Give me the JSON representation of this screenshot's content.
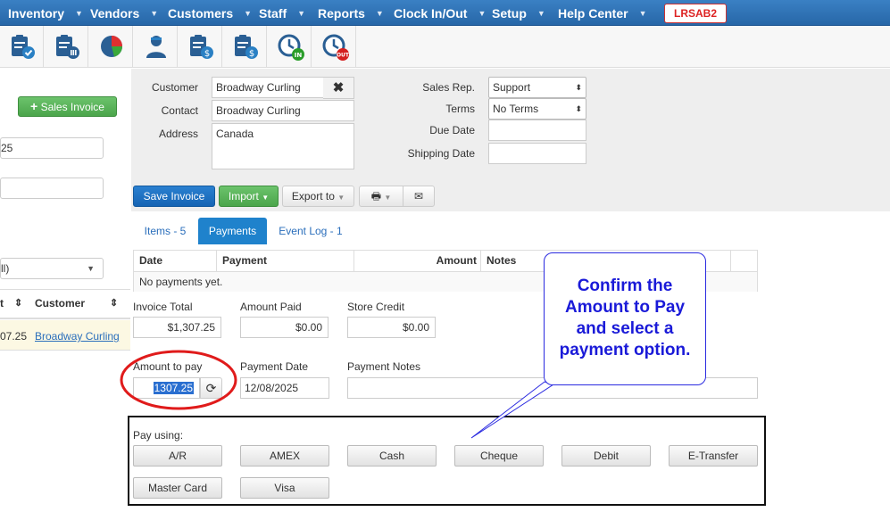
{
  "nav": {
    "items": [
      "Inventory",
      "Vendors",
      "Customers",
      "Staff",
      "Reports",
      "Clock In/Out",
      "Setup",
      "Help Center"
    ],
    "license": "LRSAB2"
  },
  "toolbar": {
    "icons": [
      "clipboard-check-icon",
      "clipboard-list-icon",
      "pie-chart-icon",
      "user-icon",
      "clipboard-dollar-icon",
      "clipboard-dollar-icon",
      "clock-in-icon",
      "clock-out-icon"
    ],
    "clock_in": "IN",
    "clock_out": "OUT"
  },
  "left": {
    "new_button": "Sales Invoice",
    "input1": "25",
    "input2": "",
    "select_value": "ll)",
    "col1": "t",
    "col2": "Customer",
    "row_amount": "07.25",
    "row_customer": "Broadway Curling"
  },
  "form": {
    "customer_label": "Customer",
    "customer_value": "Broadway Curling",
    "contact_label": "Contact",
    "contact_value": "Broadway Curling",
    "address_label": "Address",
    "address_value": "Canada",
    "salesrep_label": "Sales Rep.",
    "salesrep_value": "Support",
    "terms_label": "Terms",
    "terms_value": "No Terms",
    "duedate_label": "Due Date",
    "duedate_value": "",
    "shipdate_label": "Shipping Date",
    "shipdate_value": ""
  },
  "actions": {
    "save": "Save Invoice",
    "import": "Import",
    "export": "Export to"
  },
  "tabs": {
    "items": "Items - 5",
    "payments": "Payments",
    "eventlog": "Event Log - 1"
  },
  "payments_table": {
    "headers": [
      "Date",
      "Payment",
      "Amount",
      "Notes"
    ],
    "empty": "No payments yet."
  },
  "totals": {
    "invoice_total_label": "Invoice Total",
    "invoice_total": "$1,307.25",
    "amount_paid_label": "Amount Paid",
    "amount_paid": "$0.00",
    "store_credit_label": "Store Credit",
    "store_credit": "$0.00"
  },
  "payment": {
    "amount_label": "Amount to pay",
    "amount": "1307.25",
    "date_label": "Payment Date",
    "date": "12/08/2025",
    "notes_label": "Payment Notes",
    "notes": ""
  },
  "pay_using": {
    "label": "Pay using:",
    "options": [
      "A/R",
      "AMEX",
      "Cash",
      "Cheque",
      "Debit",
      "E-Transfer",
      "Master Card",
      "Visa"
    ]
  },
  "annotation": {
    "text": "Confirm the Amount to Pay and select a payment option.",
    "line1": "Confirm the",
    "line2": "Amount to Pay",
    "line3": "and select a",
    "line4": "payment option.",
    "circle_color": "#e01b1b",
    "callout_color": "#1a1ad8"
  }
}
